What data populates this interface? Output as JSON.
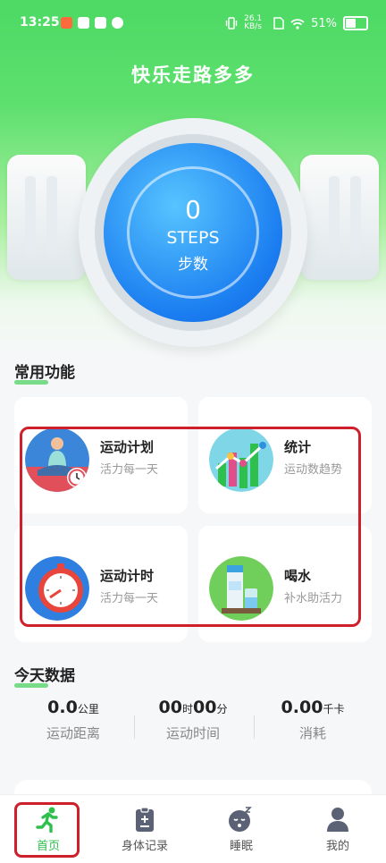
{
  "status_bar": {
    "time": "13:25",
    "network_speed": "26.1 KB/s",
    "battery": "51%"
  },
  "app_title": "快乐走路多多",
  "watch": {
    "steps": "0",
    "unit_en": "STEPS",
    "unit_zh": "步数"
  },
  "features": {
    "title": "常用功能",
    "items": [
      {
        "title": "运动计划",
        "subtitle": "活力每一天",
        "icon": "meditation-icon"
      },
      {
        "title": "统计",
        "subtitle": "运动数趋势",
        "icon": "chart-icon"
      },
      {
        "title": "运动计时",
        "subtitle": "活力每一天",
        "icon": "stopwatch-icon"
      },
      {
        "title": "喝水",
        "subtitle": "补水助活力",
        "icon": "water-icon"
      }
    ]
  },
  "today": {
    "title": "今天数据",
    "stats": [
      {
        "value": "0.0",
        "unit": "公里",
        "label": "运动距离"
      },
      {
        "value_hours": "00",
        "unit_hours": "时",
        "value_minutes": "00",
        "unit_minutes": "分",
        "label": "运动时间"
      },
      {
        "value": "0.00",
        "unit": "千卡",
        "label": "消耗"
      }
    ]
  },
  "tabbar": {
    "items": [
      {
        "label": "首页",
        "icon": "running-icon",
        "active": true
      },
      {
        "label": "身体记录",
        "icon": "clipboard-icon",
        "active": false
      },
      {
        "label": "睡眠",
        "icon": "sleep-icon",
        "active": false
      },
      {
        "label": "我的",
        "icon": "profile-icon",
        "active": false
      }
    ]
  },
  "colors": {
    "accent": "#2fbf4c",
    "highlight": "#cf1f2a",
    "watch_blue": "#1a7cf0"
  }
}
